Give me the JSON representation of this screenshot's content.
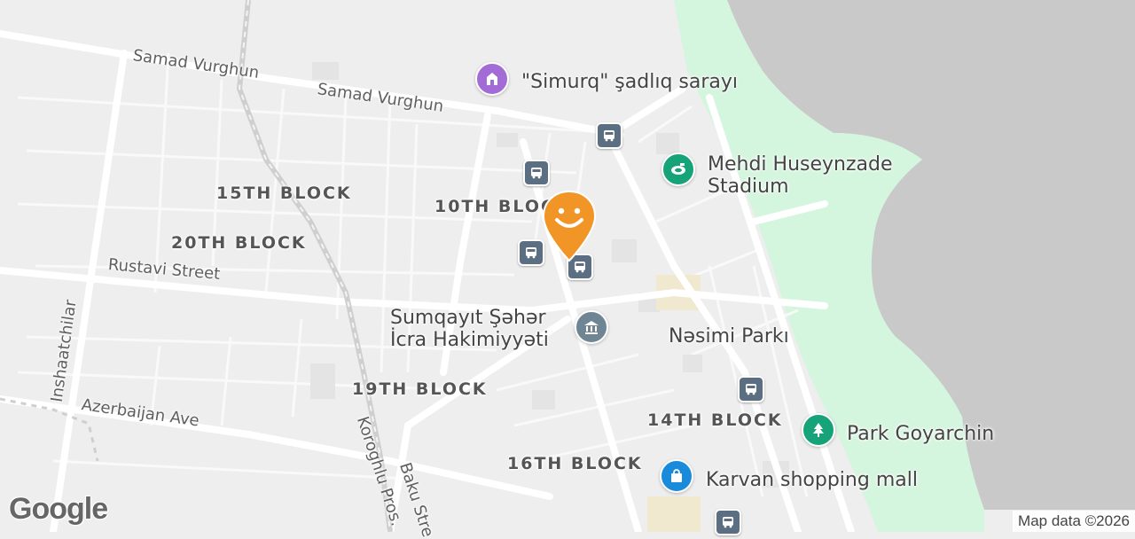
{
  "map": {
    "colors": {
      "land": "#eeeeee",
      "road": "#ffffff",
      "water": "#c9c9c9",
      "park": "#d4f5de",
      "pin": "#f29527",
      "bus": "#5b6e82"
    },
    "streets": [
      {
        "id": "samad-vurghun-west",
        "name": "Samad Vurghun"
      },
      {
        "id": "samad-vurghun-east",
        "name": "Samad Vurghun"
      },
      {
        "id": "rustavi",
        "name": "Rustavi Street"
      },
      {
        "id": "azerbaijan-ave",
        "name": "Azerbaijan Ave"
      },
      {
        "id": "inshaatchilar",
        "name": "Inshaatchilar"
      },
      {
        "id": "koroghlu",
        "name": "Koroghlu Pros."
      },
      {
        "id": "baku",
        "name": "Baku Stre"
      }
    ],
    "blocks": [
      "15TH BLOCK",
      "10TH BLOCK",
      "20TH BLOCK",
      "19TH BLOCK",
      "14TH BLOCK",
      "16TH BLOCK"
    ],
    "pois": [
      {
        "id": "simurq",
        "name": "\"Simurq\" şadlıq sarayı",
        "icon": "wedding-hall-icon",
        "color": "#a36bd6"
      },
      {
        "id": "stadium",
        "name_line1": "Mehdi Huseynzade",
        "name_line2": "Stadium",
        "icon": "stadium-icon",
        "color": "#16a37a"
      },
      {
        "id": "city-hall",
        "name_line1": "Sumqayıt Şəhər",
        "name_line2": "İcra Hakimiyyəti",
        "icon": "government-building-icon",
        "color": "#6f8594"
      },
      {
        "id": "nesimi",
        "name": "Nəsimi Parkı"
      },
      {
        "id": "park-goyarchin",
        "name": "Park Goyarchin",
        "icon": "park-tree-icon",
        "color": "#16a37a"
      },
      {
        "id": "karvan",
        "name": "Karvan shopping mall",
        "icon": "shopping-bag-icon",
        "color": "#1a8bdb"
      }
    ],
    "logo": "Google",
    "attribution": "Map data ©2026"
  }
}
